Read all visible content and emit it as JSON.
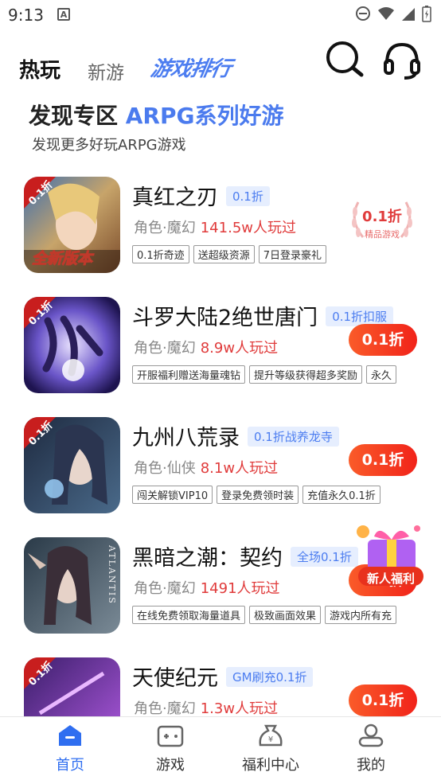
{
  "status_bar": {
    "time": "9:13",
    "notification_letter": "A"
  },
  "top_tabs": [
    {
      "label": "热玩"
    },
    {
      "label": "新游"
    },
    {
      "label": "游戏排行"
    }
  ],
  "section": {
    "title_prefix": "发现专区",
    "title_highlight": "ARPG系列好游",
    "subtitle": "发现更多好玩ARPG游戏"
  },
  "games": [
    {
      "name": "真红之刃",
      "tag": "0.1折",
      "category": "角色·魔幻",
      "players": "141.5w人玩过",
      "labels": [
        "0.1折奇迹",
        "送超级资源",
        "7日登录豪礼"
      ],
      "icon_badge": "0.1折",
      "icon_banner": "全新版本",
      "wreath_top": "0.1折",
      "wreath_bottom": "精品游戏"
    },
    {
      "name": "斗罗大陆2绝世唐门",
      "tag": "0.1折扣服",
      "category": "角色·魔幻",
      "players": "8.9w人玩过",
      "labels": [
        "开服福利赠送海量魂钻",
        "提升等级获得超多奖励",
        "永久"
      ],
      "icon_badge": "0.1折",
      "button": "0.1折"
    },
    {
      "name": "九州八荒录",
      "tag": "0.1折战养龙寺",
      "category": "角色·仙侠",
      "players": "8.1w人玩过",
      "labels": [
        "闯关解锁VIP10",
        "登录免费领时装",
        "充值永久0.1折"
      ],
      "icon_badge": "0.1折",
      "button": "0.1折"
    },
    {
      "name": "黑暗之潮：契约",
      "tag": "全场0.1折",
      "category": "角色·魔幻",
      "players": "1491人玩过",
      "labels": [
        "在线免费领取海量道具",
        "极致画面效果",
        "游戏内所有充"
      ],
      "icon_text": "ATLANTIS",
      "button": "0.1折",
      "gift_label": "新人福利"
    },
    {
      "name": "天使纪元",
      "tag": "GM刷充0.1折",
      "category": "角色·魔幻",
      "players": "1.3w人玩过",
      "labels": [],
      "icon_badge": "0.1折",
      "button": "0.1折"
    }
  ],
  "bottom_nav": [
    {
      "label": "首页"
    },
    {
      "label": "游戏"
    },
    {
      "label": "福利中心"
    },
    {
      "label": "我的"
    }
  ],
  "colors": {
    "accent": "#4c7df0",
    "play_count": "#e03b3b",
    "button": "#f1231a",
    "active_nav": "#2f6ef0"
  }
}
